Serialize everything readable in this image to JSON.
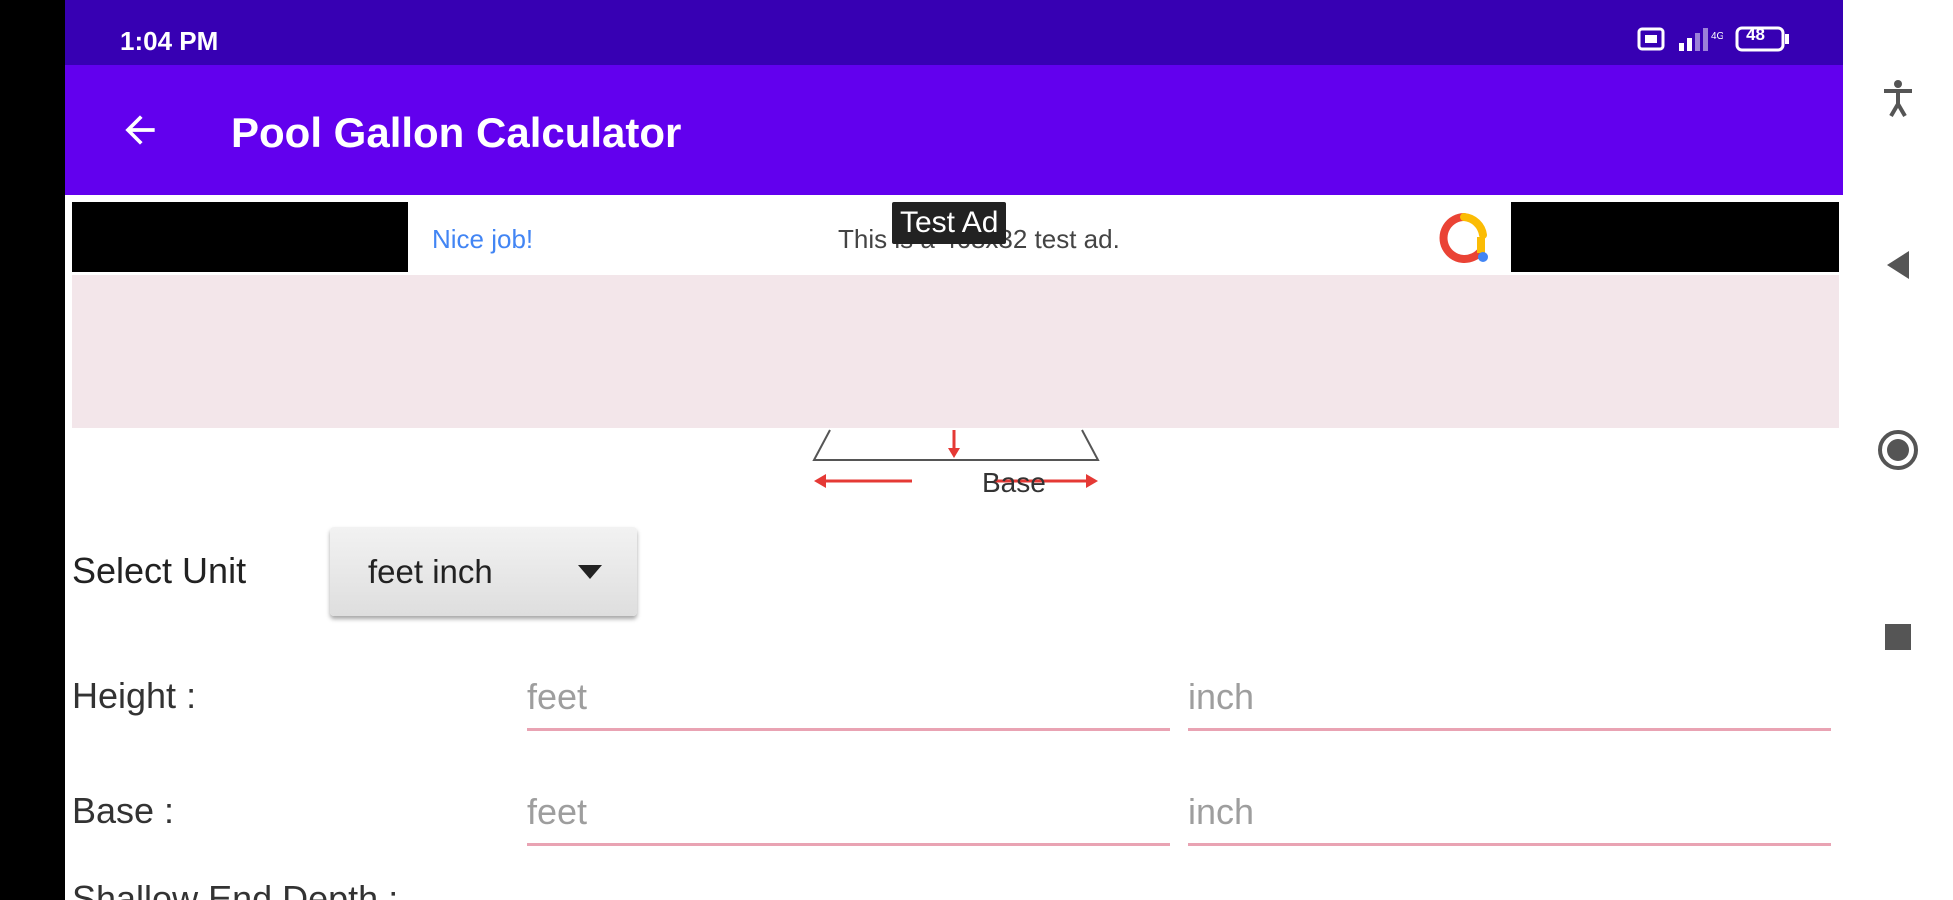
{
  "status_bar": {
    "time": "1:04 PM",
    "battery": "48"
  },
  "app_bar": {
    "title": "Pool Gallon Calculator",
    "back_icon": "arrow-left-icon"
  },
  "ad": {
    "nice_job": "Nice job!",
    "text": "This is a 468x32 test ad.",
    "badge": "Test Ad"
  },
  "diagram": {
    "base_label": "Base"
  },
  "form": {
    "select_unit_label": "Select Unit",
    "unit_value": "feet inch",
    "height_label": "Height :",
    "base_label": "Base :",
    "feet_placeholder": "feet",
    "inch_placeholder": "inch",
    "clipped_label": "Shallow End Depth :"
  },
  "colors": {
    "status_bar": "#3700b3",
    "app_bar": "#6200ee",
    "field_underline": "#e9a3b3",
    "pink_panel": "#f3e6ea"
  }
}
